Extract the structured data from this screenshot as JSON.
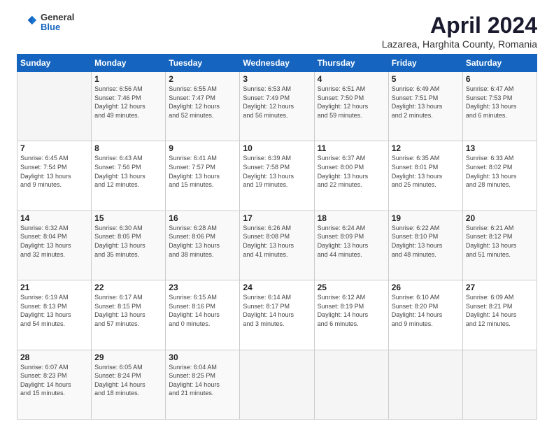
{
  "header": {
    "logo_general": "General",
    "logo_blue": "Blue",
    "title": "April 2024",
    "subtitle": "Lazarea, Harghita County, Romania"
  },
  "calendar": {
    "headers": [
      "Sunday",
      "Monday",
      "Tuesday",
      "Wednesday",
      "Thursday",
      "Friday",
      "Saturday"
    ],
    "weeks": [
      [
        {
          "day": "",
          "info": ""
        },
        {
          "day": "1",
          "info": "Sunrise: 6:56 AM\nSunset: 7:46 PM\nDaylight: 12 hours\nand 49 minutes."
        },
        {
          "day": "2",
          "info": "Sunrise: 6:55 AM\nSunset: 7:47 PM\nDaylight: 12 hours\nand 52 minutes."
        },
        {
          "day": "3",
          "info": "Sunrise: 6:53 AM\nSunset: 7:49 PM\nDaylight: 12 hours\nand 56 minutes."
        },
        {
          "day": "4",
          "info": "Sunrise: 6:51 AM\nSunset: 7:50 PM\nDaylight: 12 hours\nand 59 minutes."
        },
        {
          "day": "5",
          "info": "Sunrise: 6:49 AM\nSunset: 7:51 PM\nDaylight: 13 hours\nand 2 minutes."
        },
        {
          "day": "6",
          "info": "Sunrise: 6:47 AM\nSunset: 7:53 PM\nDaylight: 13 hours\nand 6 minutes."
        }
      ],
      [
        {
          "day": "7",
          "info": "Sunrise: 6:45 AM\nSunset: 7:54 PM\nDaylight: 13 hours\nand 9 minutes."
        },
        {
          "day": "8",
          "info": "Sunrise: 6:43 AM\nSunset: 7:56 PM\nDaylight: 13 hours\nand 12 minutes."
        },
        {
          "day": "9",
          "info": "Sunrise: 6:41 AM\nSunset: 7:57 PM\nDaylight: 13 hours\nand 15 minutes."
        },
        {
          "day": "10",
          "info": "Sunrise: 6:39 AM\nSunset: 7:58 PM\nDaylight: 13 hours\nand 19 minutes."
        },
        {
          "day": "11",
          "info": "Sunrise: 6:37 AM\nSunset: 8:00 PM\nDaylight: 13 hours\nand 22 minutes."
        },
        {
          "day": "12",
          "info": "Sunrise: 6:35 AM\nSunset: 8:01 PM\nDaylight: 13 hours\nand 25 minutes."
        },
        {
          "day": "13",
          "info": "Sunrise: 6:33 AM\nSunset: 8:02 PM\nDaylight: 13 hours\nand 28 minutes."
        }
      ],
      [
        {
          "day": "14",
          "info": "Sunrise: 6:32 AM\nSunset: 8:04 PM\nDaylight: 13 hours\nand 32 minutes."
        },
        {
          "day": "15",
          "info": "Sunrise: 6:30 AM\nSunset: 8:05 PM\nDaylight: 13 hours\nand 35 minutes."
        },
        {
          "day": "16",
          "info": "Sunrise: 6:28 AM\nSunset: 8:06 PM\nDaylight: 13 hours\nand 38 minutes."
        },
        {
          "day": "17",
          "info": "Sunrise: 6:26 AM\nSunset: 8:08 PM\nDaylight: 13 hours\nand 41 minutes."
        },
        {
          "day": "18",
          "info": "Sunrise: 6:24 AM\nSunset: 8:09 PM\nDaylight: 13 hours\nand 44 minutes."
        },
        {
          "day": "19",
          "info": "Sunrise: 6:22 AM\nSunset: 8:10 PM\nDaylight: 13 hours\nand 48 minutes."
        },
        {
          "day": "20",
          "info": "Sunrise: 6:21 AM\nSunset: 8:12 PM\nDaylight: 13 hours\nand 51 minutes."
        }
      ],
      [
        {
          "day": "21",
          "info": "Sunrise: 6:19 AM\nSunset: 8:13 PM\nDaylight: 13 hours\nand 54 minutes."
        },
        {
          "day": "22",
          "info": "Sunrise: 6:17 AM\nSunset: 8:15 PM\nDaylight: 13 hours\nand 57 minutes."
        },
        {
          "day": "23",
          "info": "Sunrise: 6:15 AM\nSunset: 8:16 PM\nDaylight: 14 hours\nand 0 minutes."
        },
        {
          "day": "24",
          "info": "Sunrise: 6:14 AM\nSunset: 8:17 PM\nDaylight: 14 hours\nand 3 minutes."
        },
        {
          "day": "25",
          "info": "Sunrise: 6:12 AM\nSunset: 8:19 PM\nDaylight: 14 hours\nand 6 minutes."
        },
        {
          "day": "26",
          "info": "Sunrise: 6:10 AM\nSunset: 8:20 PM\nDaylight: 14 hours\nand 9 minutes."
        },
        {
          "day": "27",
          "info": "Sunrise: 6:09 AM\nSunset: 8:21 PM\nDaylight: 14 hours\nand 12 minutes."
        }
      ],
      [
        {
          "day": "28",
          "info": "Sunrise: 6:07 AM\nSunset: 8:23 PM\nDaylight: 14 hours\nand 15 minutes."
        },
        {
          "day": "29",
          "info": "Sunrise: 6:05 AM\nSunset: 8:24 PM\nDaylight: 14 hours\nand 18 minutes."
        },
        {
          "day": "30",
          "info": "Sunrise: 6:04 AM\nSunset: 8:25 PM\nDaylight: 14 hours\nand 21 minutes."
        },
        {
          "day": "",
          "info": ""
        },
        {
          "day": "",
          "info": ""
        },
        {
          "day": "",
          "info": ""
        },
        {
          "day": "",
          "info": ""
        }
      ]
    ]
  }
}
